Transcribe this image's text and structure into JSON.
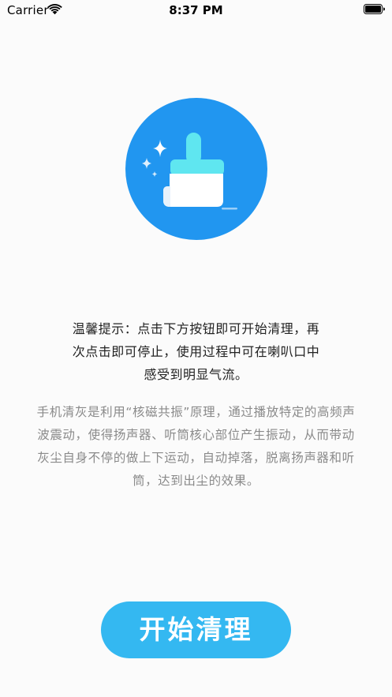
{
  "status_bar": {
    "carrier": "Carrier",
    "time": "8:37 PM"
  },
  "hero": {
    "icon": "broom-clean-icon",
    "background_color": "#2196f0",
    "brush_color": "#5fe6f0"
  },
  "tip": {
    "line1": "温馨提示：点击下方按钮即可开始清理，再",
    "line2": "次点击即可停止，使用过程中可在喇叭口中",
    "line3": "感受到明显气流。"
  },
  "description": {
    "line1": "手机清灰是利用“核磁共振”原理，通过播放特定的高频声",
    "line2": "波震动，使得扬声器、听筒核心部位产生振动，从而带动",
    "line3": "灰尘自身不停的做上下运动，自动掉落，脱离扬声器和听",
    "line4": "筒，达到出尘的效果。"
  },
  "start_button": {
    "label": "开始清理",
    "color": "#34b8f1"
  }
}
